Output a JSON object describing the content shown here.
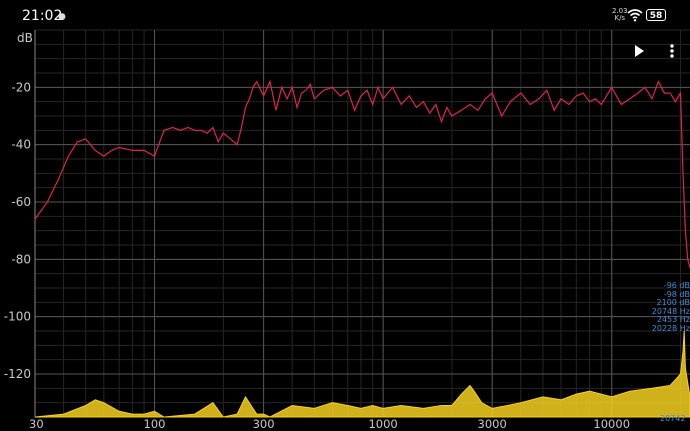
{
  "status_bar": {
    "time": "21:02",
    "speed_value": "2.03",
    "speed_unit": "K/s",
    "battery": "58",
    "icons": [
      "notification-dot-icon",
      "wifi-icon",
      "battery-icon"
    ]
  },
  "controls": {
    "play_icon": "play-icon",
    "menu_icon": "more-vertical-icon"
  },
  "readout": {
    "lines": [
      "-96 dB",
      "-98 dB",
      "2100 dB",
      "20748 Hz",
      "2453 Hz",
      "20228 Hz"
    ],
    "peak_label": "20742"
  },
  "colors": {
    "background": "#000000",
    "spectrum_line": "#e0234e",
    "fill_spectrum": "#f5d020",
    "grid_major": "#555555",
    "grid_minor": "#262626",
    "readout": "#3d8fd6"
  },
  "chart_data": {
    "type": "line",
    "ylabel": "dB",
    "x_scale": "log",
    "xlim": [
      30,
      22000
    ],
    "ylim": [
      -135,
      0
    ],
    "x_ticks": [
      30,
      100,
      300,
      1000,
      3000,
      10000
    ],
    "x_tick_labels": [
      "30",
      "100",
      "300",
      "1000",
      "3000",
      "10000"
    ],
    "y_ticks": [
      -20,
      -40,
      -60,
      -80,
      -100,
      -120
    ],
    "y_tick_labels": [
      "-20",
      "-40",
      "-60",
      "-80",
      "-100",
      "-120"
    ],
    "grid": true,
    "series": [
      {
        "role": "spectrum-peak",
        "color": "#e0234e",
        "x": [
          30,
          34,
          38,
          42,
          46,
          50,
          55,
          60,
          65,
          70,
          80,
          90,
          100,
          110,
          120,
          130,
          140,
          150,
          160,
          170,
          180,
          190,
          200,
          215,
          230,
          240,
          250,
          260,
          270,
          280,
          300,
          320,
          340,
          360,
          380,
          400,
          420,
          440,
          460,
          480,
          500,
          550,
          600,
          650,
          700,
          750,
          800,
          850,
          900,
          950,
          1000,
          1100,
          1200,
          1300,
          1400,
          1500,
          1600,
          1700,
          1800,
          1900,
          2000,
          2200,
          2400,
          2600,
          2800,
          3000,
          3300,
          3600,
          4000,
          4400,
          4800,
          5200,
          5600,
          6000,
          6500,
          7000,
          7500,
          8000,
          8500,
          9000,
          10000,
          11000,
          12000,
          13000,
          14000,
          15000,
          16000,
          17000,
          18000,
          19000,
          20000,
          20500,
          21000,
          21500,
          22000
        ],
        "y": [
          -66,
          -60,
          -52,
          -44,
          -39,
          -38,
          -42,
          -44,
          -42,
          -41,
          -42,
          -42,
          -44,
          -35,
          -34,
          -35,
          -34,
          -35,
          -35,
          -36,
          -34,
          -39,
          -36,
          -38,
          -40,
          -34,
          -27,
          -24,
          -20,
          -18,
          -23,
          -18,
          -28,
          -20,
          -24,
          -20,
          -27,
          -22,
          -21,
          -19,
          -24,
          -21,
          -20,
          -23,
          -21,
          -28,
          -23,
          -21,
          -26,
          -20,
          -24,
          -20,
          -26,
          -23,
          -27,
          -25,
          -29,
          -26,
          -32,
          -27,
          -30,
          -28,
          -26,
          -28,
          -24,
          -22,
          -30,
          -25,
          -22,
          -26,
          -24,
          -21,
          -28,
          -24,
          -26,
          -23,
          -22,
          -25,
          -24,
          -26,
          -20,
          -26,
          -24,
          -22,
          -20,
          -24,
          -18,
          -22,
          -22,
          -25,
          -22,
          -50,
          -70,
          -80,
          -83
        ]
      },
      {
        "role": "spectrum-live",
        "color": "#f5d020",
        "x": [
          30,
          40,
          50,
          55,
          60,
          70,
          80,
          90,
          100,
          110,
          150,
          180,
          200,
          230,
          250,
          280,
          300,
          320,
          400,
          500,
          600,
          700,
          800,
          900,
          1000,
          1200,
          1500,
          1800,
          2000,
          2200,
          2400,
          2500,
          2700,
          3000,
          3500,
          4000,
          5000,
          6000,
          7000,
          8000,
          10000,
          12000,
          15000,
          18000,
          19000,
          20000,
          20500,
          20742,
          21000,
          22000
        ],
        "y": [
          -135,
          -134,
          -131,
          -129,
          -130,
          -133,
          -134,
          -134,
          -133,
          -135,
          -134,
          -130,
          -135,
          -134,
          -128,
          -134,
          -134,
          -135,
          -131,
          -132,
          -130,
          -131,
          -132,
          -131,
          -132,
          -131,
          -132,
          -131,
          -131,
          -127,
          -124,
          -126,
          -130,
          -132,
          -131,
          -130,
          -128,
          -129,
          -127,
          -126,
          -128,
          -126,
          -125,
          -124,
          -122,
          -120,
          -112,
          -105,
          -118,
          -128
        ]
      }
    ]
  }
}
